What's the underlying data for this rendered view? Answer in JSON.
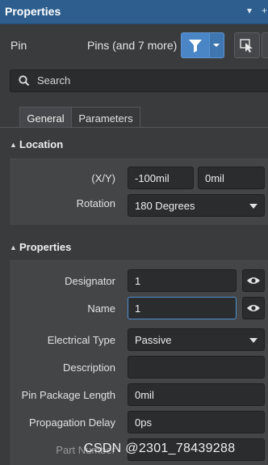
{
  "panel": {
    "title": "Properties",
    "pin_menu_glyph": "▾",
    "pin_add_glyph": "+"
  },
  "pin_row": {
    "label": "Pin",
    "filter_text": "Pins (and 7 more)",
    "filter_icon": "funnel-icon",
    "select_icon": "cursor-select-icon"
  },
  "search": {
    "placeholder": "Search",
    "icon": "search-icon"
  },
  "tabs": [
    {
      "label": "General",
      "active": true
    },
    {
      "label": "Parameters",
      "active": false
    }
  ],
  "location": {
    "title": "Location",
    "xy_label": "(X/Y)",
    "x_value": "-100mil",
    "y_value": "0mil",
    "rotation_label": "Rotation",
    "rotation_value": "180 Degrees"
  },
  "properties": {
    "title": "Properties",
    "designator_label": "Designator",
    "designator_value": "1",
    "name_label": "Name",
    "name_value": "1",
    "electrical_type_label": "Electrical Type",
    "electrical_type_value": "Passive",
    "description_label": "Description",
    "description_value": "",
    "pin_package_length_label": "Pin Package Length",
    "pin_package_length_value": "0mil",
    "propagation_delay_label": "Propagation Delay",
    "propagation_delay_value": "0ps",
    "part_number_label": "Part Number"
  },
  "watermark": "CSDN @2301_78439288",
  "colors": {
    "title_bar": "#2d5e8e",
    "accent": "#4a86c5",
    "background": "#3a3b3d",
    "field": "#2b2c2e",
    "focus_border": "#4e8fd1"
  }
}
